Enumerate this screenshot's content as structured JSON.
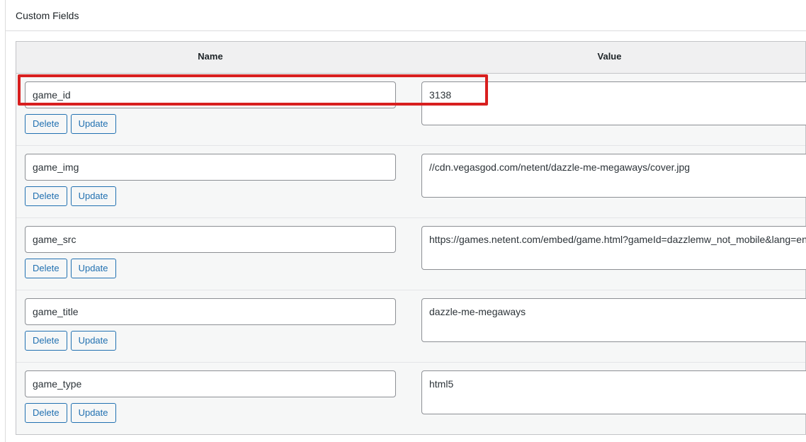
{
  "panel": {
    "title": "Custom Fields"
  },
  "table": {
    "headers": {
      "name": "Name",
      "value": "Value"
    },
    "buttons": {
      "delete": "Delete",
      "update": "Update"
    },
    "rows": [
      {
        "name": "game_id",
        "value": "3138"
      },
      {
        "name": "game_img",
        "value": "//cdn.vegasgod.com/netent/dazzle-me-megaways/cover.jpg"
      },
      {
        "name": "game_src",
        "value": "https://games.netent.com/embed/game.html?gameId=dazzlemw_not_mobile&lang=en"
      },
      {
        "name": "game_title",
        "value": "dazzle-me-megaways"
      },
      {
        "name": "game_type",
        "value": "html5"
      }
    ]
  },
  "annotation": {
    "highlight_color": "#d81f1f",
    "target": "game_id"
  },
  "colors": {
    "accent": "#2271b1",
    "header_background": "#f0f0f1",
    "row_background": "#f6f7f7",
    "border": "#c3c4c7",
    "text": "#1d2327"
  }
}
